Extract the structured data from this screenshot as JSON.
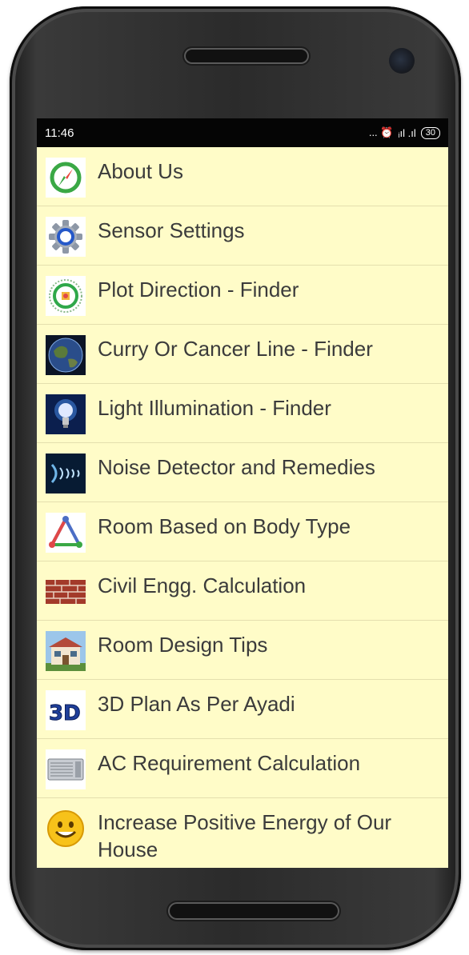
{
  "status_bar": {
    "time": "11:46",
    "indicators": "... ⏰ ",
    "signal": "ᵢıl .ıl",
    "battery": "30"
  },
  "menu": {
    "items": [
      {
        "label": "About Us",
        "icon": "compass-icon"
      },
      {
        "label": "Sensor Settings",
        "icon": "gear-icon"
      },
      {
        "label": "Plot Direction - Finder",
        "icon": "direction-dial-icon"
      },
      {
        "label": "Curry Or Cancer Line - Finder",
        "icon": "globe-icon"
      },
      {
        "label": "Light Illumination - Finder",
        "icon": "light-bulb-icon"
      },
      {
        "label": "Noise Detector and Remedies",
        "icon": "sound-wave-icon"
      },
      {
        "label": "Room Based on Body Type",
        "icon": "triangle-elements-icon"
      },
      {
        "label": "Civil Engg. Calculation",
        "icon": "brick-wall-icon"
      },
      {
        "label": "Room Design Tips",
        "icon": "house-icon"
      },
      {
        "label": "3D Plan As Per Ayadi",
        "icon": "3d-icon"
      },
      {
        "label": "AC Requirement Calculation",
        "icon": "air-conditioner-icon"
      },
      {
        "label": "Increase Positive Energy of Our House",
        "icon": "smiley-icon"
      }
    ]
  },
  "colors": {
    "list_background": "#fffcc8",
    "status_bar": "#050505",
    "text": "#3b3b3b",
    "divider": "#e4dfae"
  }
}
